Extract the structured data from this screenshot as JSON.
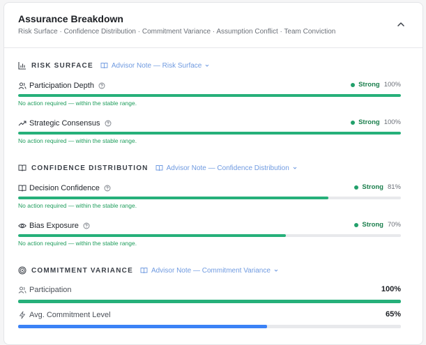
{
  "header": {
    "title": "Assurance Breakdown",
    "subtitle": "Risk Surface · Confidence Distribution · Commitment Variance · Assumption Conflict · Team Conviction",
    "collapse_icon": "chevron-up-icon"
  },
  "colors": {
    "accent_green": "#26b07a",
    "accent_blue": "#3b82f6",
    "advisor_blue": "#6f9ae0",
    "note_green": "#1f9d5c"
  },
  "sections": {
    "risk": {
      "title": "RISK SURFACE",
      "advisor": "Advisor Note — Risk Surface",
      "metrics": [
        {
          "label": "Participation Depth",
          "status": "Strong",
          "pct": "100%",
          "value": 100,
          "note": "No action required — within the stable range."
        },
        {
          "label": "Strategic Consensus",
          "status": "Strong",
          "pct": "100%",
          "value": 100,
          "note": "No action required — within the stable range."
        }
      ]
    },
    "confidence": {
      "title": "CONFIDENCE DISTRIBUTION",
      "advisor": "Advisor Note — Confidence Distribution",
      "metrics": [
        {
          "label": "Decision Confidence",
          "status": "Strong",
          "pct": "81%",
          "value": 81,
          "note": "No action required — within the stable range."
        },
        {
          "label": "Bias Exposure",
          "status": "Strong",
          "pct": "70%",
          "value": 70,
          "note": "No action required — within the stable range."
        }
      ]
    },
    "commitment": {
      "title": "COMMITMENT VARIANCE",
      "advisor": "Advisor Note — Commitment Variance",
      "metrics": [
        {
          "label": "Participation",
          "pct": "100%",
          "value": 100
        },
        {
          "label": "Avg. Commitment Level",
          "pct": "65%",
          "value": 65
        }
      ]
    }
  }
}
